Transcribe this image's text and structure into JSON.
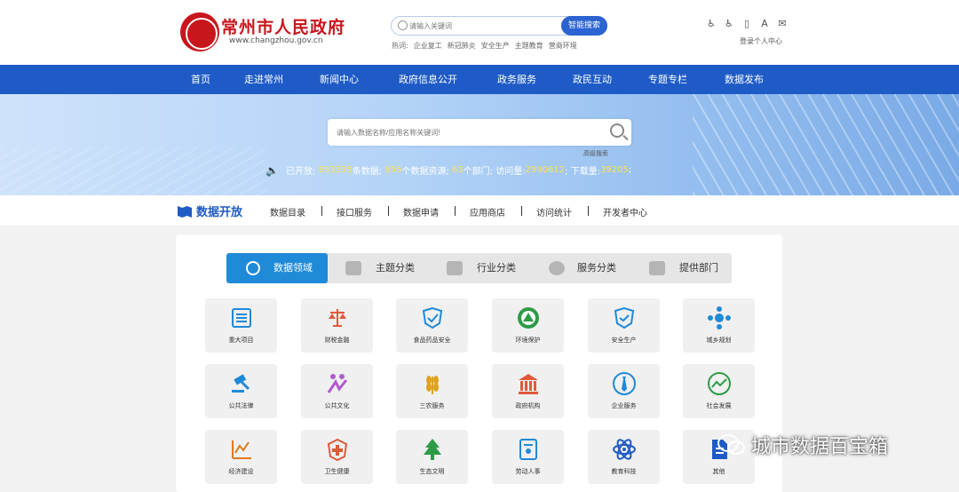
{
  "header": {
    "site_name": "常州市人民政府",
    "site_url": "www.changzhou.gov.cn",
    "search_placeholder": "请输入关键词",
    "search_button": "智能搜索",
    "hot_label": "热词:",
    "hot_words": [
      "企业复工",
      "新冠肺炎",
      "安全生产",
      "主题教育",
      "营商环境"
    ],
    "login": "登录个人中心",
    "tool_icons": [
      "accessibility-icon",
      "wheelchair-icon",
      "mobile-icon",
      "font-size-icon",
      "mail-icon"
    ]
  },
  "nav": {
    "items": [
      "首页",
      "走进常州",
      "新闻中心",
      "政府信息公开",
      "政务服务",
      "政民互动",
      "专题专栏",
      "数据发布"
    ]
  },
  "banner": {
    "search_placeholder": "请输入数据名称/应用名称关键词!",
    "advanced": "高级搜索",
    "stats": {
      "opened_label": "已开放:",
      "data_count": "833335",
      "data_unit": "条数据;",
      "resource_count": "656",
      "resource_unit": "个数据资源;",
      "dept_count": "63",
      "dept_unit": "个部门;",
      "visits_label": "访问量:",
      "visits": "2990612",
      "downloads_label": ";  下载量:",
      "downloads": "39205",
      "end": ";"
    }
  },
  "subnav": {
    "title": "数据开放",
    "links": [
      "数据目录",
      "接口服务",
      "数据申请",
      "应用商店",
      "访问统计",
      "开发者中心"
    ]
  },
  "tabs": [
    "数据领域",
    "主题分类",
    "行业分类",
    "服务分类",
    "提供部门"
  ],
  "categories": [
    {
      "label": "重大项目",
      "icon": "list-icon",
      "color": "#1f8ad8"
    },
    {
      "label": "财税金融",
      "icon": "scales-icon",
      "color": "#e05a3a"
    },
    {
      "label": "食品药品安全",
      "icon": "check-shield-icon",
      "color": "#1f8ad8"
    },
    {
      "label": "环境保护",
      "icon": "environment-badge-icon",
      "color": "#2e9b46"
    },
    {
      "label": "安全生产",
      "icon": "shield-icon",
      "color": "#1f8ad8"
    },
    {
      "label": "城乡规划",
      "icon": "network-icon",
      "color": "#1f8ad8"
    },
    {
      "label": "公共法律",
      "icon": "gavel-icon",
      "color": "#1f8ad8"
    },
    {
      "label": "公共文化",
      "icon": "people-icon",
      "color": "#b05ad0"
    },
    {
      "label": "三农服务",
      "icon": "wheat-icon",
      "color": "#e0a21f"
    },
    {
      "label": "政府机构",
      "icon": "building-icon",
      "color": "#e05a3a"
    },
    {
      "label": "企业服务",
      "icon": "tie-icon",
      "color": "#1f8ad8"
    },
    {
      "label": "社会发展",
      "icon": "trend-icon",
      "color": "#2e9b46"
    },
    {
      "label": "经济建设",
      "icon": "chart-icon",
      "color": "#e07a1f"
    },
    {
      "label": "卫生健康",
      "icon": "medical-icon",
      "color": "#e05a3a"
    },
    {
      "label": "生态文明",
      "icon": "tree-icon",
      "color": "#2e9b46"
    },
    {
      "label": "劳动人事",
      "icon": "document-person-icon",
      "color": "#1f8ad8"
    },
    {
      "label": "教育科技",
      "icon": "atom-icon",
      "color": "#1f5bc6"
    },
    {
      "label": "其他",
      "icon": "file-icon",
      "color": "#1f5bc6"
    }
  ],
  "watermark": "城市数据百宝箱"
}
